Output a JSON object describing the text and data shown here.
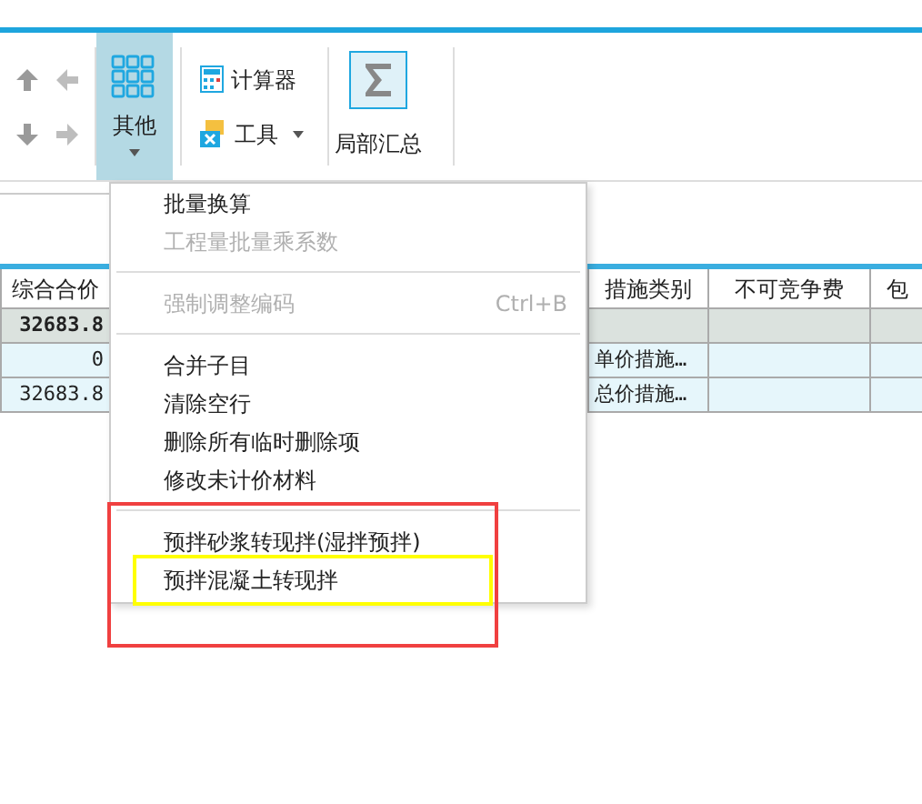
{
  "toolbar": {
    "other_button": {
      "label": "其他",
      "selected": true
    },
    "calculator": {
      "label": "计算器"
    },
    "tools": {
      "label": "工具"
    },
    "subtotal": {
      "label": "局部汇总"
    }
  },
  "table": {
    "columns": [
      "综合合价",
      "",
      "措施类别",
      "不可竞争费",
      "包"
    ],
    "rows": [
      {
        "kind": "total",
        "cells": [
          "32683.8",
          "",
          "",
          "",
          ""
        ]
      },
      {
        "kind": "item",
        "cells": [
          "0",
          "",
          "单价措施…",
          "",
          ""
        ]
      },
      {
        "kind": "item",
        "cells": [
          "32683.8",
          "",
          "总价措施…",
          "",
          ""
        ]
      }
    ]
  },
  "menu": {
    "items": [
      {
        "kind": "item",
        "label": "批量换算",
        "disabled": false
      },
      {
        "kind": "item",
        "label": "工程量批量乘系数",
        "disabled": true
      },
      {
        "kind": "separator"
      },
      {
        "kind": "item",
        "label": "强制调整编码",
        "shortcut": "Ctrl+B",
        "disabled": true
      },
      {
        "kind": "separator"
      },
      {
        "kind": "item",
        "label": "合并子目",
        "disabled": false
      },
      {
        "kind": "item",
        "label": "清除空行",
        "disabled": false
      },
      {
        "kind": "item",
        "label": "删除所有临时删除项",
        "disabled": false
      },
      {
        "kind": "item",
        "label": "修改未计价材料",
        "disabled": false
      },
      {
        "kind": "separator"
      },
      {
        "kind": "item",
        "label": "预拌砂浆转现拌(湿拌预拌)",
        "disabled": false
      },
      {
        "kind": "item",
        "label": "预拌混凝土转现拌",
        "disabled": false
      }
    ]
  },
  "annotations": [
    {
      "color": "#f04040"
    },
    {
      "color": "#ffff00"
    }
  ]
}
